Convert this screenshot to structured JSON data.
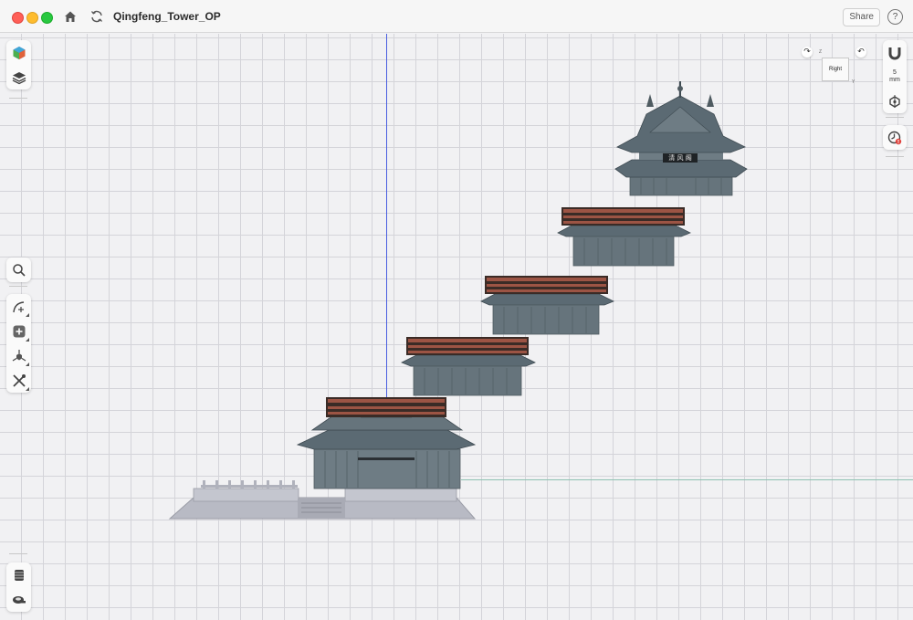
{
  "window": {
    "title": "Qingfeng_Tower_OP",
    "share_label": "Share",
    "help_label": "?",
    "traffic_lights": [
      "close",
      "minimize",
      "zoom"
    ]
  },
  "left_toolbar": {
    "top_tools": [
      {
        "name": "appearance-cube-icon"
      },
      {
        "name": "layers-icon"
      }
    ],
    "main_tools": [
      {
        "name": "search-icon"
      },
      {
        "name": "sketch-curve-icon"
      },
      {
        "name": "add-shape-icon"
      },
      {
        "name": "transform-icon"
      },
      {
        "name": "tools-icon"
      }
    ],
    "bottom_tools": [
      {
        "name": "print-spring-icon"
      },
      {
        "name": "measure-tape-icon"
      }
    ]
  },
  "right_toolbar": {
    "snap_value": "5",
    "snap_unit": "mm",
    "tools": [
      "magnet-icon",
      "grid-snap-icon",
      "history-clock-icon"
    ]
  },
  "viewcube": {
    "face_label": "Right",
    "axis_z": "Z",
    "axis_y": "Y"
  },
  "model": {
    "name": "Qingfeng Tower exploded view",
    "parts": [
      "base-platform",
      "ground-floor-hall",
      "balcony-tier-1",
      "balcony-tier-2",
      "balcony-tier-3",
      "top-pavilion"
    ],
    "plaque_text": "清 风 阁"
  },
  "colors": {
    "roof": "#5b6a73",
    "railing": "#8f4b3c",
    "base": "#b8bac4",
    "axis_blue": "#4a5ee0",
    "axis_green": "#8fc1b2"
  }
}
